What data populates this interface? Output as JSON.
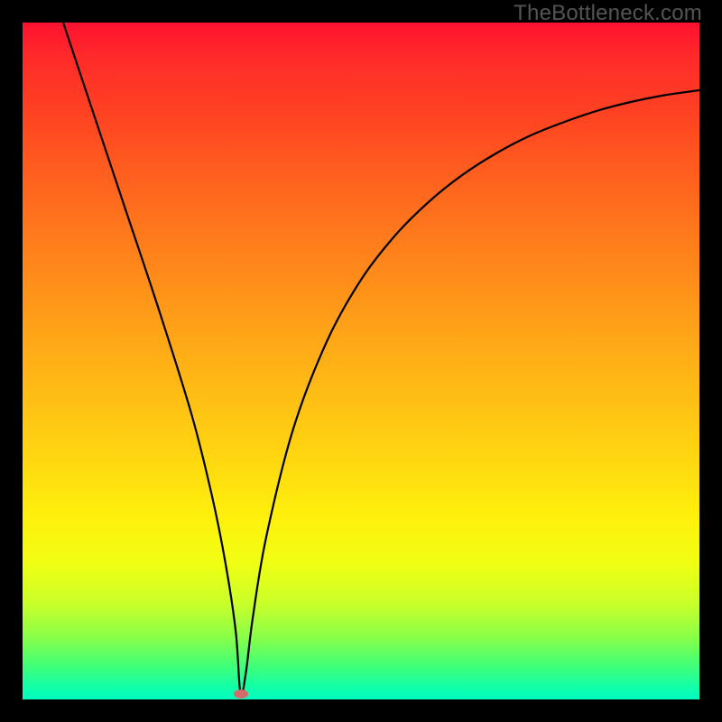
{
  "watermark": "TheBottleneck.com",
  "chart_data": {
    "type": "line",
    "title": "",
    "xlabel": "",
    "ylabel": "",
    "xlim": [
      0,
      100
    ],
    "ylim": [
      0,
      100
    ],
    "grid": false,
    "series": [
      {
        "name": "curve",
        "x": [
          6,
          10,
          15,
          20,
          25,
          28,
          30,
          31.5,
          32.2,
          33,
          34,
          36,
          40,
          45,
          50,
          55,
          60,
          65,
          70,
          75,
          80,
          85,
          90,
          95,
          100
        ],
        "y": [
          100,
          88,
          73,
          58,
          42,
          30,
          20,
          10,
          0.8,
          4,
          12,
          24,
          40,
          53,
          62,
          68.5,
          73.5,
          77.5,
          80.7,
          83.3,
          85.3,
          87,
          88.3,
          89.3,
          90
        ]
      }
    ],
    "marker": {
      "x": 32.2,
      "y": 0.8,
      "color": "#d46a6b"
    },
    "background_gradient": [
      "#ff1130",
      "#ff8a1a",
      "#fff00c",
      "#00ffc0"
    ]
  }
}
